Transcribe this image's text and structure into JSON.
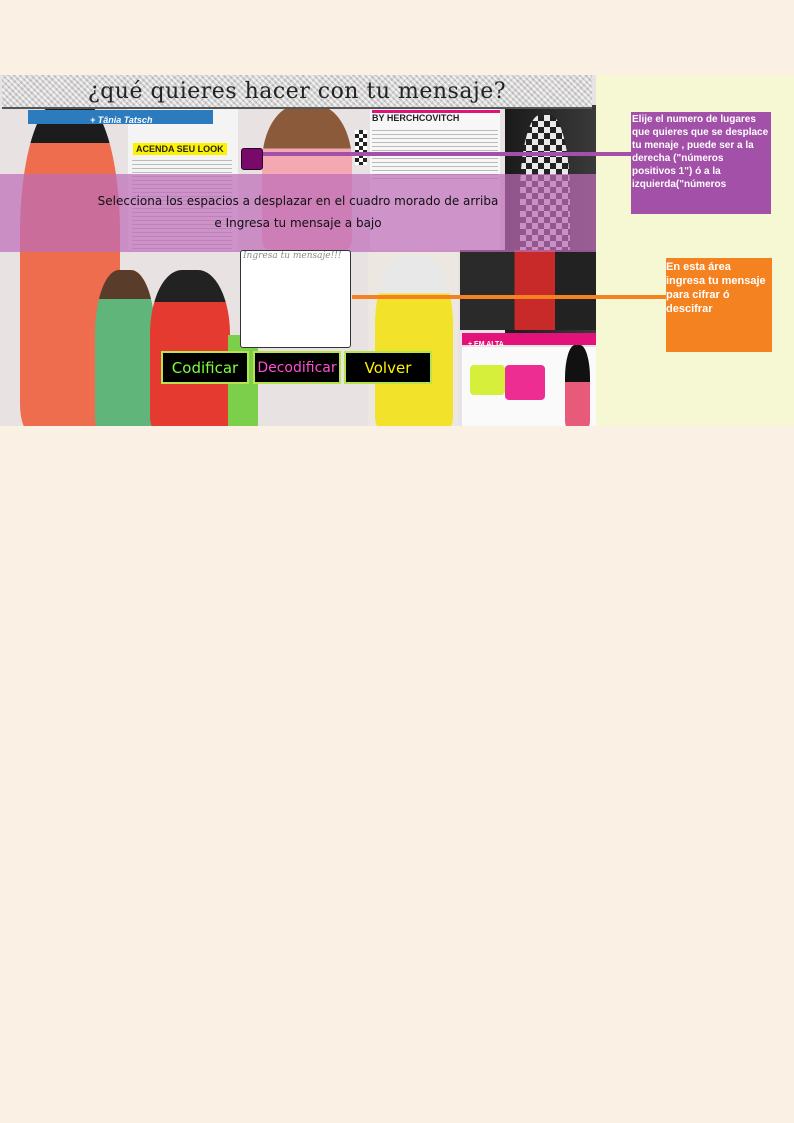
{
  "title": "¿qué quieres hacer con tu mensaje?",
  "magazine": {
    "tab_text": "+ Tânia Tatsch",
    "headline": "ACENDA SEU LOOK",
    "byline": "BY HERCHCOVITCH",
    "section": "+ EM ALTA"
  },
  "instructions": {
    "line1": "Selecciona los espacios a desplazar en el cuadro morado de arriba",
    "line2": "e Ingresa tu mensaje a bajo"
  },
  "message_input": {
    "placeholder": "Ingresa tu mensaje!!!"
  },
  "buttons": {
    "encode": "Codificar",
    "decode": "Decodificar",
    "back": "Volver"
  },
  "callouts": {
    "shift": "Elije el numero de lugares que quieres que se desplace tu menaje , puede ser a la derecha (\"números positivos 1\") ó a la izquierda(\"números",
    "message": "En esta área ingresa tu mensaje para cifrar ó descifrar"
  },
  "colors": {
    "page_bg": "#fbf0e4",
    "side_panel": "#f5f8d3",
    "purple": "#a350a8",
    "orange": "#f58220",
    "selector": "#7a0a6a"
  }
}
